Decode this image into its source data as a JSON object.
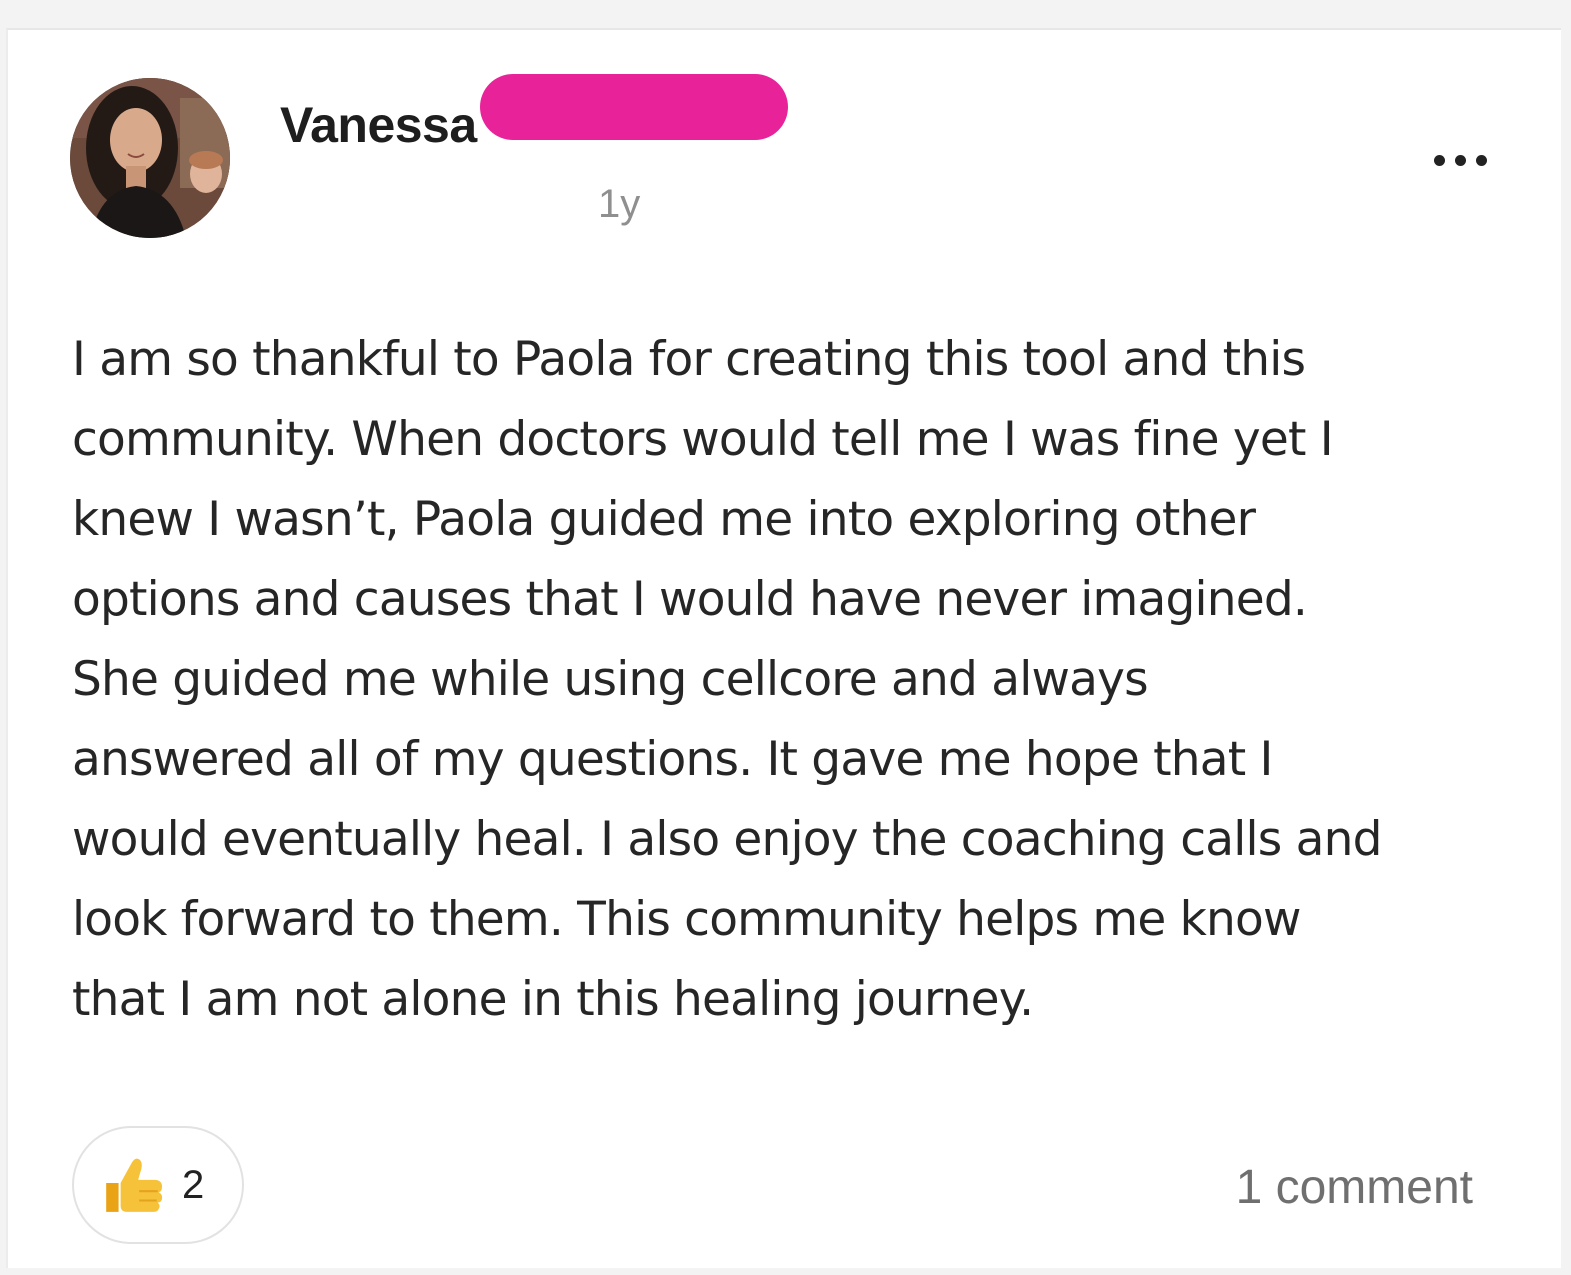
{
  "post": {
    "author_name": "Vanessa",
    "redaction_color": "#e8239a",
    "timestamp": "1y",
    "more_icon": "more-horizontal-icon",
    "body_lines": [
      "I am so thankful to Paola for creating this tool and this",
      "community. When doctors would tell me I was fine yet I",
      "knew I wasn’t, Paola guided me into exploring other",
      "options and causes that I would have never imagined.",
      "She guided me while using cellcore and always",
      "answered all of my questions. It gave me hope that I",
      "would eventually heal. I also enjoy the coaching calls and",
      "look forward to them. This community helps me know",
      "that I am not alone in this healing journey."
    ]
  },
  "reactions": {
    "icon": "thumbs-up-icon",
    "count": "2"
  },
  "comments": {
    "label": "1 comment"
  }
}
